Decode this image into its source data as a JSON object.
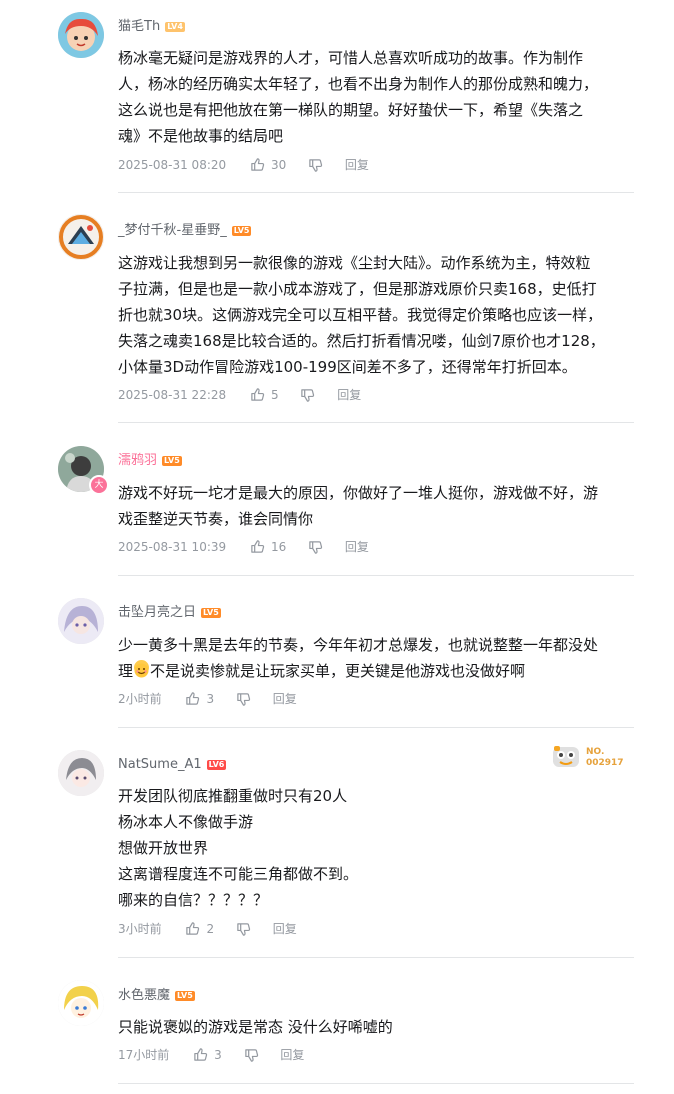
{
  "comments": [
    {
      "username": "猫毛Th",
      "level": "LV4",
      "content": [
        "杨冰毫无疑问是游戏界的人才，可惜人总喜欢听成功的故事。作为制作",
        "人，杨冰的经历确实太年轻了，也看不出身为制作人的那份成熟和魄力，",
        "这么说也是有把他放在第一梯队的期望。好好蛰伏一下，希望《失落之",
        "魂》不是他故事的结局吧"
      ],
      "time": "2025-08-31 08:20",
      "likes": "30",
      "reply_label": "回复"
    },
    {
      "username": "_梦付千秋-星垂野_",
      "level": "LV5",
      "content": [
        "这游戏让我想到另一款很像的游戏《尘封大陆》。动作系统为主，特效粒",
        "子拉满，但是也是一款小成本游戏了，但是那游戏原价只卖168，史低打",
        "折也就30块。这俩游戏完全可以互相平替。我觉得定价策略也应该一样，",
        "失落之魂卖168是比较合适的。然后打折看情况喽，仙剑7原价也才128，",
        "小体量3D动作冒险游戏100-199区间差不多了，还得常年打折回本。"
      ],
      "time": "2025-08-31 22:28",
      "likes": "5",
      "reply_label": "回复"
    },
    {
      "username": "濡鸦羽",
      "level": "LV5",
      "vip_mark": "大",
      "content": [
        "游戏不好玩一坨才是最大的原因，你做好了一堆人挺你，游戏做不好，游",
        "戏歪整逆天节奏，谁会同情你"
      ],
      "time": "2025-08-31 10:39",
      "likes": "16",
      "reply_label": "回复"
    },
    {
      "username": "击坠月亮之日",
      "level": "LV5",
      "content_line1": "少一黄多十黑是去年的节奏，今年年初才总爆发，也就说整整一年都没处",
      "content_line2_a": "理",
      "content_line2_b": "不是说卖惨就是让玩家买单，更关键是他游戏也没做好啊",
      "time": "2小时前",
      "likes": "3",
      "reply_label": "回复"
    },
    {
      "username": "NatSume_A1",
      "level": "LV6",
      "badge_no_label": "NO.",
      "badge_no": "002917",
      "content": [
        "开发团队彻底推翻重做时只有20人",
        "杨冰本人不像做手游",
        "想做开放世界",
        "这离谱程度连不可能三角都做不到。",
        "哪来的自信？？？？？"
      ],
      "time": "3小时前",
      "likes": "2",
      "reply_label": "回复"
    },
    {
      "username": "水色悪魔",
      "level": "LV5",
      "content": [
        "只能说褒姒的游戏是常态 没什么好唏嘘的"
      ],
      "time": "17小时前",
      "likes": "3",
      "reply_label": "回复"
    }
  ],
  "colors": {
    "username": "#61666d",
    "vip_username": "#fb7299",
    "meta": "#9499a0",
    "divider": "#e3e5e7"
  }
}
